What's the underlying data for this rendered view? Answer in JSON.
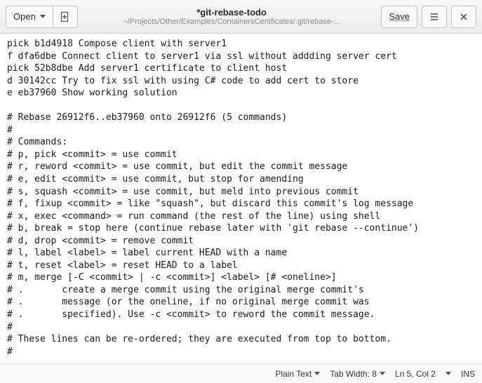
{
  "header": {
    "open_label": "Open",
    "save_label": "Save",
    "title": "*git-rebase-todo",
    "subtitle": "~/Projects/Other/Examples/ContainersCertificates/.git/rebase-..."
  },
  "editor": {
    "lines": [
      "pick b1d4918 Compose client with server1",
      "f dfa6dbe Connect client to server1 via ssl without addding server cert",
      "pick 52b8dbe Add server1 certificate to client host",
      "d 30142cc Try to fix ssl with using C# code to add cert to store",
      "e eb37960 Show working solution",
      "",
      "# Rebase 26912f6..eb37960 onto 26912f6 (5 commands)",
      "#",
      "# Commands:",
      "# p, pick <commit> = use commit",
      "# r, reword <commit> = use commit, but edit the commit message",
      "# e, edit <commit> = use commit, but stop for amending",
      "# s, squash <commit> = use commit, but meld into previous commit",
      "# f, fixup <commit> = like \"squash\", but discard this commit's log message",
      "# x, exec <command> = run command (the rest of the line) using shell",
      "# b, break = stop here (continue rebase later with 'git rebase --continue')",
      "# d, drop <commit> = remove commit",
      "# l, label <label> = label current HEAD with a name",
      "# t, reset <label> = reset HEAD to a label",
      "# m, merge [-C <commit> | -c <commit>] <label> [# <oneline>]",
      "# .       create a merge commit using the original merge commit's",
      "# .       message (or the oneline, if no original merge commit was",
      "# .       specified). Use -c <commit> to reword the commit message.",
      "#",
      "# These lines can be re-ordered; they are executed from top to bottom.",
      "#"
    ]
  },
  "status": {
    "syntax": "Plain Text",
    "tab_width": "Tab Width: 8",
    "position": "Ln 5, Col 2",
    "insert_mode": "INS"
  }
}
